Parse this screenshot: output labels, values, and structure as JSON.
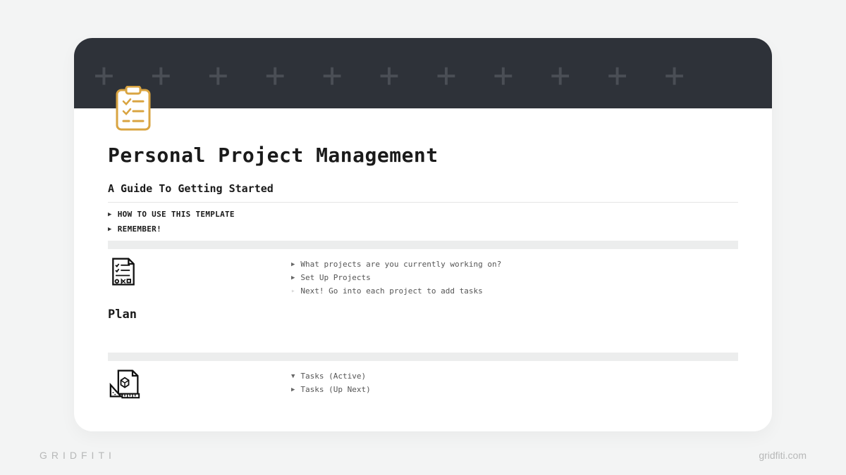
{
  "page": {
    "title": "Personal Project Management",
    "subtitle": "A Guide To Getting Started"
  },
  "intro_toggles": [
    {
      "label": "HOW TO USE THIS TEMPLATE"
    },
    {
      "label": "REMEMBER!"
    }
  ],
  "plan": {
    "heading": "Plan",
    "bullets": [
      {
        "label": "What projects are you currently working on?",
        "marker": "closed"
      },
      {
        "label": "Set Up Projects",
        "marker": "closed"
      },
      {
        "label": "Next! Go into each project to add tasks",
        "marker": "dim"
      }
    ]
  },
  "tasks": {
    "bullets": [
      {
        "label": "Tasks (Active)",
        "marker": "open"
      },
      {
        "label": "Tasks (Up Next)",
        "marker": "closed"
      }
    ]
  },
  "watermark": {
    "brand": "GRIDFITI",
    "url": "gridfiti.com"
  },
  "colors": {
    "cover_bg": "#2e3239",
    "accent": "#d9a441"
  }
}
